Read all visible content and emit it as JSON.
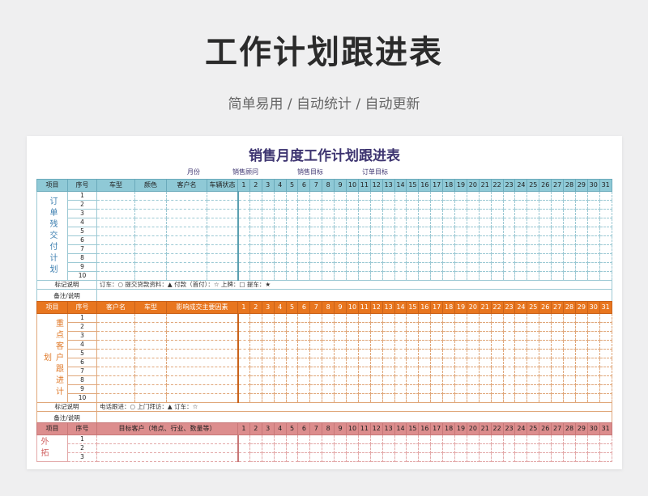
{
  "header": {
    "title": "工作计划跟进表",
    "subtitle": "简单易用 / 自动统计 / 自动更新"
  },
  "sheet": {
    "title": "销售月度工作计划跟进表",
    "info": [
      "月份",
      "销售顾问",
      "销售目标",
      "订单目标"
    ]
  },
  "days": [
    "1",
    "2",
    "3",
    "4",
    "5",
    "6",
    "7",
    "8",
    "9",
    "10",
    "11",
    "12",
    "13",
    "14",
    "15",
    "16",
    "17",
    "18",
    "19",
    "20",
    "21",
    "22",
    "23",
    "24",
    "25",
    "26",
    "27",
    "28",
    "29",
    "30",
    "31"
  ],
  "rows": [
    "1",
    "2",
    "3",
    "4",
    "5",
    "6",
    "7",
    "8",
    "9",
    "10"
  ],
  "section1": {
    "headers": [
      "项目",
      "序号",
      "车型",
      "颜色",
      "客户名",
      "车辆状态"
    ],
    "side_label": "订单残交付计划",
    "mark_label": "标记说明",
    "mark_text": "订车：○   提交贷款资料：▲   付款（首付）：☆   上牌：□   提车：★",
    "note_label": "备注/说明"
  },
  "section2": {
    "headers": [
      "项目",
      "序号",
      "客户名",
      "车型",
      "影响成交主要因素"
    ],
    "side_label": "重点客户跟进计划",
    "mark_label": "标记说明",
    "mark_text": "电话跟进：○   上门拜访：▲   订车：☆",
    "note_label": "备注/说明"
  },
  "section3": {
    "headers": [
      "项目",
      "序号",
      "目标客户（地点、行业、数量等）"
    ],
    "side_label": "外拓",
    "rows": [
      "1",
      "2",
      "3"
    ]
  },
  "colors": {
    "blue_header": "#8fc9d6",
    "orange_header": "#e8761f",
    "pink_header": "#dc8d8d",
    "title_purple": "#3d3470"
  }
}
